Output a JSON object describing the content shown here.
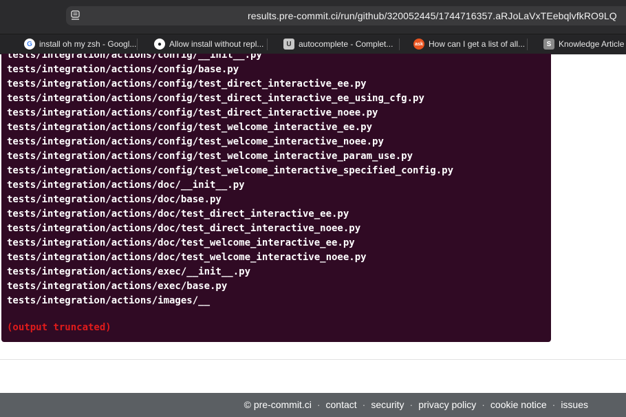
{
  "browser": {
    "url": "results.pre-commit.ci/run/github/320052445/1744716357.aRJoLaVxTEebqlvfkRO9LQ",
    "bookmarks": [
      {
        "label": "install oh my zsh - Googl...",
        "icon": "google-icon"
      },
      {
        "label": "Allow install without repl...",
        "icon": "github-icon"
      },
      {
        "label": "autocomplete - Complet...",
        "icon": "unix-linux-icon"
      },
      {
        "label": "How can I get a list of all...",
        "icon": "ask-ubuntu-icon"
      },
      {
        "label": "Knowledge Article V",
        "icon": "s-icon"
      }
    ]
  },
  "terminal": {
    "lines": [
      "tests/integration/actions/config/__init__.py",
      "tests/integration/actions/config/base.py",
      "tests/integration/actions/config/test_direct_interactive_ee.py",
      "tests/integration/actions/config/test_direct_interactive_ee_using_cfg.py",
      "tests/integration/actions/config/test_direct_interactive_noee.py",
      "tests/integration/actions/config/test_welcome_interactive_ee.py",
      "tests/integration/actions/config/test_welcome_interactive_noee.py",
      "tests/integration/actions/config/test_welcome_interactive_param_use.py",
      "tests/integration/actions/config/test_welcome_interactive_specified_config.py",
      "tests/integration/actions/doc/__init__.py",
      "tests/integration/actions/doc/base.py",
      "tests/integration/actions/doc/test_direct_interactive_ee.py",
      "tests/integration/actions/doc/test_direct_interactive_noee.py",
      "tests/integration/actions/doc/test_welcome_interactive_ee.py",
      "tests/integration/actions/doc/test_welcome_interactive_noee.py",
      "tests/integration/actions/exec/__init__.py",
      "tests/integration/actions/exec/base.py",
      "tests/integration/actions/images/__"
    ],
    "truncated_notice": "(output truncated)",
    "colors": {
      "background": "#300a24",
      "text": "#ffffff",
      "notice": "#e01b1b"
    }
  },
  "footer": {
    "copyright": "© pre-commit.ci",
    "links": [
      "contact",
      "security",
      "privacy policy",
      "cookie notice",
      "issues"
    ],
    "separator": "·"
  }
}
